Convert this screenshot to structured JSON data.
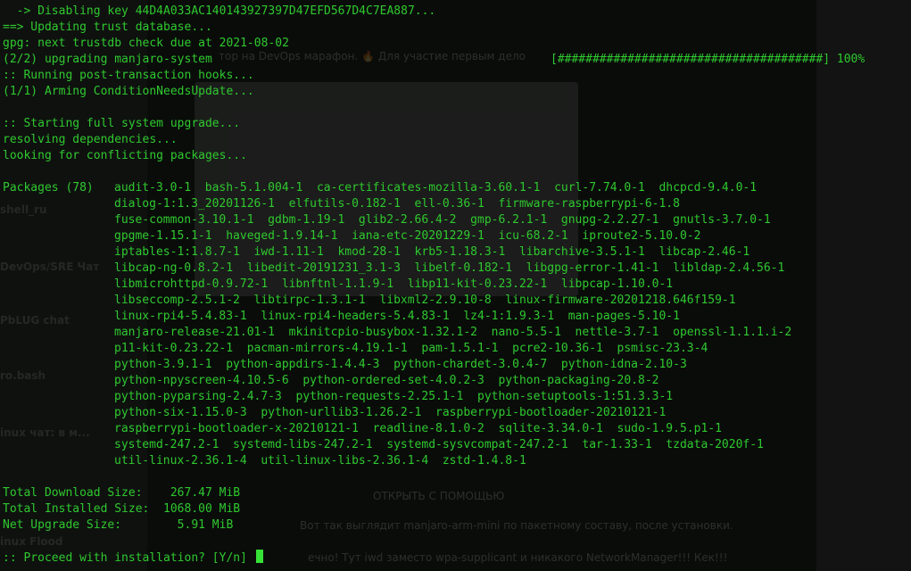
{
  "background": {
    "chats": [
      "shell_ru",
      "DevOps/SRE Чат",
      "PbLUG chat",
      "ro.bash",
      "inux чат: в м...",
      "inux Flood"
    ],
    "message_1": "тор на DevOps марафон. 🔥 Для участие первым дело",
    "message_2": "Вот так выглядит manjaro-arm-mini по пакетному составу, после установки.",
    "message_3": "ечно! Тут iwd заместо wpa-supplicant и никакого NetworkManager!!! Кек!!!",
    "open_with": "ОТКРЫТЬ С ПОМОЩЬЮ"
  },
  "terminal": {
    "lines": [
      "  -> Disabling key 44D4A033AC140143927397D47EFD567D4C7EA887...",
      "==> Updating trust database...",
      "gpg: next trustdb check due at 2021-08-02",
      "(2/2) upgrading manjaro-system",
      ":: Running post-transaction hooks...",
      "(1/1) Arming ConditionNeedsUpdate...",
      "",
      ":: Starting full system upgrade...",
      "resolving dependencies...",
      "looking for conflicting packages...",
      ""
    ],
    "progress_bar": "[######################################] 100%",
    "packages_label": "Packages (78)",
    "packages": [
      "audit-3.0-1  bash-5.1.004-1  ca-certificates-mozilla-3.60.1-1  curl-7.74.0-1  dhcpcd-9.4.0-1",
      "dialog-1:1.3_20201126-1  elfutils-0.182-1  ell-0.36-1  firmware-raspberrypi-6-1.8",
      "fuse-common-3.10.1-1  gdbm-1.19-1  glib2-2.66.4-2  gmp-6.2.1-1  gnupg-2.2.27-1  gnutls-3.7.0-1",
      "gpgme-1.15.1-1  haveged-1.9.14-1  iana-etc-20201229-1  icu-68.2-1  iproute2-5.10.0-2",
      "iptables-1:1.8.7-1  iwd-1.11-1  kmod-28-1  krb5-1.18.3-1  libarchive-3.5.1-1  libcap-2.46-1",
      "libcap-ng-0.8.2-1  libedit-20191231_3.1-3  libelf-0.182-1  libgpg-error-1.41-1  libldap-2.4.56-1",
      "libmicrohttpd-0.9.72-1  libnftnl-1.1.9-1  libp11-kit-0.23.22-1  libpcap-1.10.0-1",
      "libseccomp-2.5.1-2  libtirpc-1.3.1-1  libxml2-2.9.10-8  linux-firmware-20201218.646f159-1",
      "linux-rpi4-5.4.83-1  linux-rpi4-headers-5.4.83-1  lz4-1:1.9.3-1  man-pages-5.10-1",
      "manjaro-release-21.01-1  mkinitcpio-busybox-1.32.1-2  nano-5.5-1  nettle-3.7-1  openssl-1.1.1.i-2",
      "p11-kit-0.23.22-1  pacman-mirrors-4.19.1-1  pam-1.5.1-1  pcre2-10.36-1  psmisc-23.3-4",
      "python-3.9.1-1  python-appdirs-1.4.4-3  python-chardet-3.0.4-7  python-idna-2.10-3",
      "python-npyscreen-4.10.5-6  python-ordered-set-4.0.2-3  python-packaging-20.8-2",
      "python-pyparsing-2.4.7-3  python-requests-2.25.1-1  python-setuptools-1:51.3.3-1",
      "python-six-1.15.0-3  python-urllib3-1.26.2-1  raspberrypi-bootloader-20210121-1",
      "raspberrypi-bootloader-x-20210121-1  readline-8.1.0-2  sqlite-3.34.0-1  sudo-1.9.5.p1-1",
      "systemd-247.2-1  systemd-libs-247.2-1  systemd-sysvcompat-247.2-1  tar-1.33-1  tzdata-2020f-1",
      "util-linux-2.36.1-4  util-linux-libs-2.36.1-4  zstd-1.4.8-1"
    ],
    "totals": [
      "Total Download Size:    267.47 MiB",
      "Total Installed Size:  1068.00 MiB",
      "Net Upgrade Size:        5.91 MiB"
    ],
    "prompt": ":: Proceed with installation? [Y/n] "
  }
}
